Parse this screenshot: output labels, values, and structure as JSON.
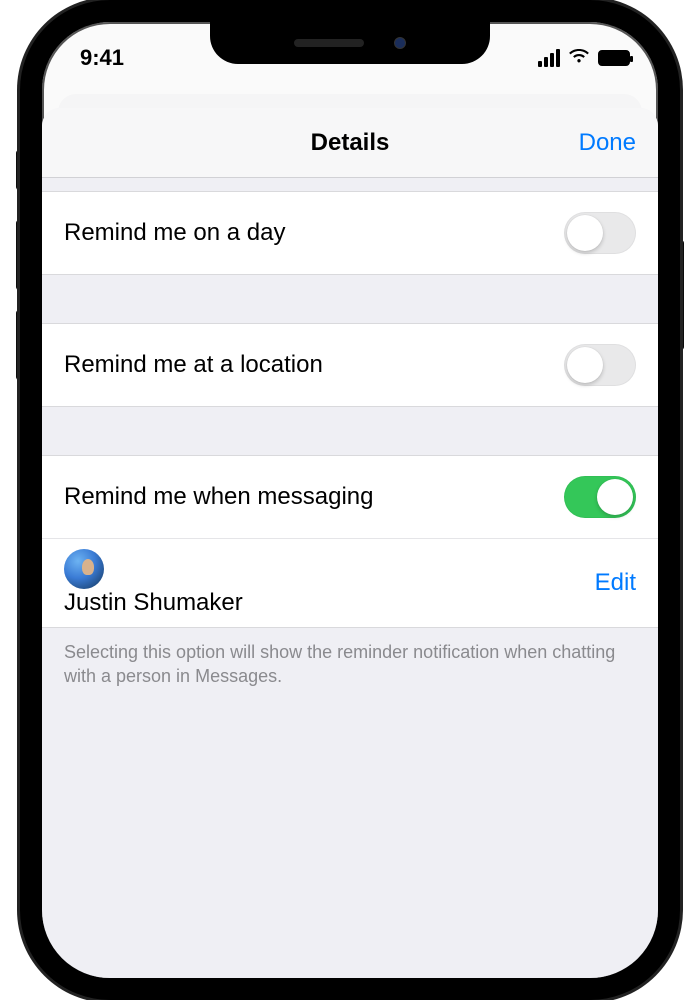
{
  "status": {
    "time": "9:41"
  },
  "nav": {
    "title": "Details",
    "done": "Done"
  },
  "rows": {
    "day": {
      "label": "Remind me on a day",
      "on": false
    },
    "location": {
      "label": "Remind me at a location",
      "on": false
    },
    "messaging": {
      "label": "Remind me when messaging",
      "on": true
    }
  },
  "contact": {
    "name": "Justin Shumaker",
    "edit": "Edit"
  },
  "footer": "Selecting this option will show the reminder notification when chatting with a person in Messages."
}
